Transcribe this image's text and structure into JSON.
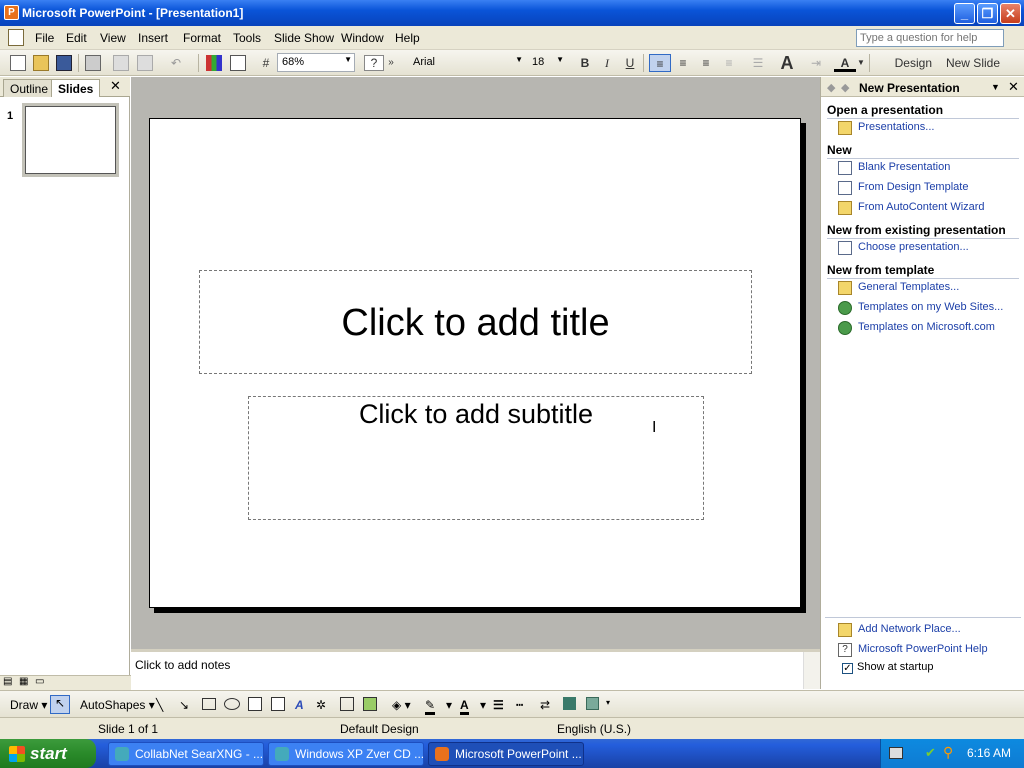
{
  "window": {
    "title": "Microsoft PowerPoint - [Presentation1]"
  },
  "menu": [
    "File",
    "Edit",
    "View",
    "Insert",
    "Format",
    "Tools",
    "Slide Show",
    "Window",
    "Help"
  ],
  "help_placeholder": "Type a question for help",
  "toolbar": {
    "zoom": "68%",
    "font": "Arial",
    "size": "18",
    "bold": "B",
    "italic": "I",
    "underline": "U",
    "design": "Design",
    "new_slide": "New Slide"
  },
  "left_pane": {
    "tabs": [
      "Outline",
      "Slides"
    ],
    "slide_number": "1"
  },
  "slide": {
    "title_placeholder": "Click to add title",
    "subtitle_placeholder": "Click to add subtitle"
  },
  "notes_placeholder": "Click to add notes",
  "task_pane": {
    "title": "New Presentation",
    "open_heading": "Open a presentation",
    "open_link": "Presentations...",
    "new_heading": "New",
    "new_links": [
      "Blank Presentation",
      "From Design Template",
      "From AutoContent Wizard"
    ],
    "existing_heading": "New from existing presentation",
    "existing_link": "Choose presentation...",
    "template_heading": "New from template",
    "template_links": [
      "General Templates...",
      "Templates on my Web Sites...",
      "Templates on Microsoft.com"
    ],
    "bottom_links": [
      "Add Network Place...",
      "Microsoft PowerPoint Help"
    ],
    "show_startup": "Show at startup"
  },
  "draw_toolbar": {
    "draw": "Draw",
    "autoshapes": "AutoShapes"
  },
  "status": {
    "slide": "Slide 1 of 1",
    "design": "Default Design",
    "language": "English (U.S.)"
  },
  "taskbar": {
    "start": "start",
    "tasks": [
      "CollabNet SearXNG - ...",
      "Windows XP Zver CD ...",
      "Microsoft PowerPoint ..."
    ],
    "clock": "6:16 AM"
  },
  "colors": {
    "accent": "#0a54d8",
    "taskbar": "#245edc",
    "start": "#2a8a2a",
    "link": "#1c3fa8"
  }
}
